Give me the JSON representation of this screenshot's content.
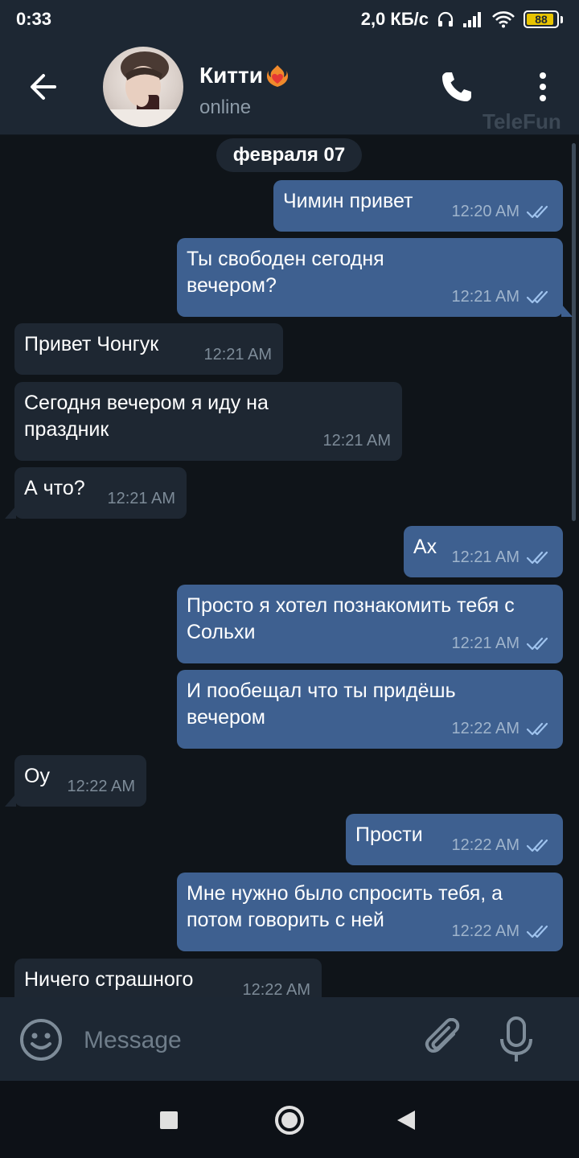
{
  "status_bar": {
    "time": "0:33",
    "network_speed": "2,0 КБ/с",
    "battery": "88",
    "icons": [
      "headset-icon",
      "signal-icon",
      "wifi-icon",
      "battery-icon"
    ]
  },
  "header": {
    "chat_name": "Китти",
    "name_emoji": "heart-on-fire-icon",
    "status": "online",
    "watermark": "TeleFun"
  },
  "chat": {
    "date_label": "февраля 07",
    "messages": [
      {
        "direction": "out",
        "text": "Чимин привет",
        "time": "12:20 AM",
        "read": true
      },
      {
        "direction": "out",
        "text": "Ты свободен сегодня вечером?",
        "time": "12:21 AM",
        "read": true
      },
      {
        "direction": "in",
        "text": "Привет Чонгук",
        "time": "12:21 AM"
      },
      {
        "direction": "in",
        "text": "Сегодня вечером я иду на праздник",
        "time": "12:21 AM"
      },
      {
        "direction": "in",
        "text": "А что?",
        "time": "12:21 AM"
      },
      {
        "direction": "out",
        "text": "Ах",
        "time": "12:21 AM",
        "read": true
      },
      {
        "direction": "out",
        "text": "Просто я хотел познакомить тебя с Сольхи",
        "time": "12:21 AM",
        "read": true
      },
      {
        "direction": "out",
        "text": "И пообещал что ты придёшь вечером",
        "time": "12:22 AM",
        "read": true
      },
      {
        "direction": "in",
        "text": "Оу",
        "time": "12:22 AM"
      },
      {
        "direction": "out",
        "text": "Прости",
        "time": "12:22 AM",
        "read": true
      },
      {
        "direction": "out",
        "text": "Мне нужно было спросить тебя, а потом говорить с ней",
        "time": "12:22 AM",
        "read": true
      },
      {
        "direction": "in",
        "text": "Ничего страшного",
        "time": "12:22 AM"
      }
    ]
  },
  "composer": {
    "placeholder": "Message"
  },
  "colors": {
    "outgoing_bubble": "#3e6090",
    "incoming_bubble": "#1e2732",
    "background": "#0f1419",
    "header": "#1d2733"
  }
}
